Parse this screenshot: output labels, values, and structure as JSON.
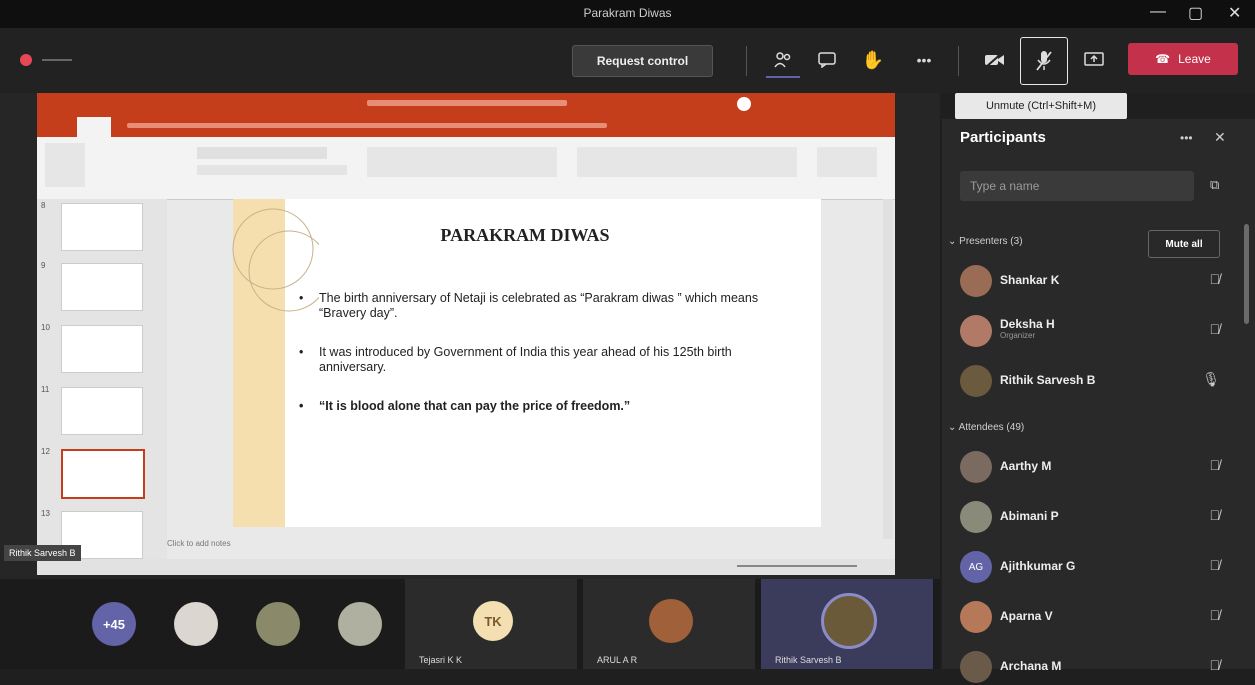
{
  "window": {
    "title": "Parakram Diwas"
  },
  "toolbar": {
    "request_control": "Request control",
    "leave": "Leave",
    "more": "•••"
  },
  "tooltip": "Unmute (Ctrl+Shift+M)",
  "presentation": {
    "slide_title": "PARAKRAM DIWAS",
    "bullets": [
      {
        "text": "The birth anniversary of Netaji is celebrated as “Parakram diwas ” which means “Bravery day”."
      },
      {
        "text": "It was introduced by Government of India this year ahead of his 125th birth anniversary."
      },
      {
        "text": "“It is blood alone that can pay the price of freedom.”"
      }
    ],
    "notes_placeholder": "Click to add notes",
    "thumb_numbers": [
      "8",
      "9",
      "10",
      "11",
      "12",
      "13"
    ],
    "presenter_tag": "Rithik Sarvesh B"
  },
  "participants": {
    "title": "Participants",
    "search_placeholder": "Type a name",
    "presenters_header": "Presenters (3)",
    "mute_all": "Mute all",
    "attendees_header": "Attendees (49)",
    "presenters": [
      {
        "name": "Shankar K",
        "sub": "",
        "icon": "mic-off-icon"
      },
      {
        "name": "Deksha H",
        "sub": "Organizer",
        "icon": "mic-off-icon"
      },
      {
        "name": "Rithik Sarvesh B",
        "sub": "",
        "icon": "mic-on-icon"
      }
    ],
    "attendees": [
      {
        "name": "Aarthy M",
        "icon": "mic-off-icon"
      },
      {
        "name": "Abimani P",
        "icon": "mic-off-icon"
      },
      {
        "name": "Ajithkumar G",
        "icon": "mic-off-icon",
        "initials": "AG"
      },
      {
        "name": "Aparna V",
        "icon": "mic-off-icon"
      },
      {
        "name": "Archana M",
        "icon": "mic-off-icon"
      }
    ]
  },
  "bottom_strip": {
    "overflow_count": "+45",
    "tiles": [
      {
        "initials": "TK",
        "label": "Tejasri K K"
      },
      {
        "label": "ARUL A R"
      },
      {
        "label": "Rithik Sarvesh B"
      }
    ]
  },
  "colors": {
    "leave": "#c4314b",
    "ppt_red": "#c43e1c",
    "avatar_purple": "#6264a7"
  }
}
